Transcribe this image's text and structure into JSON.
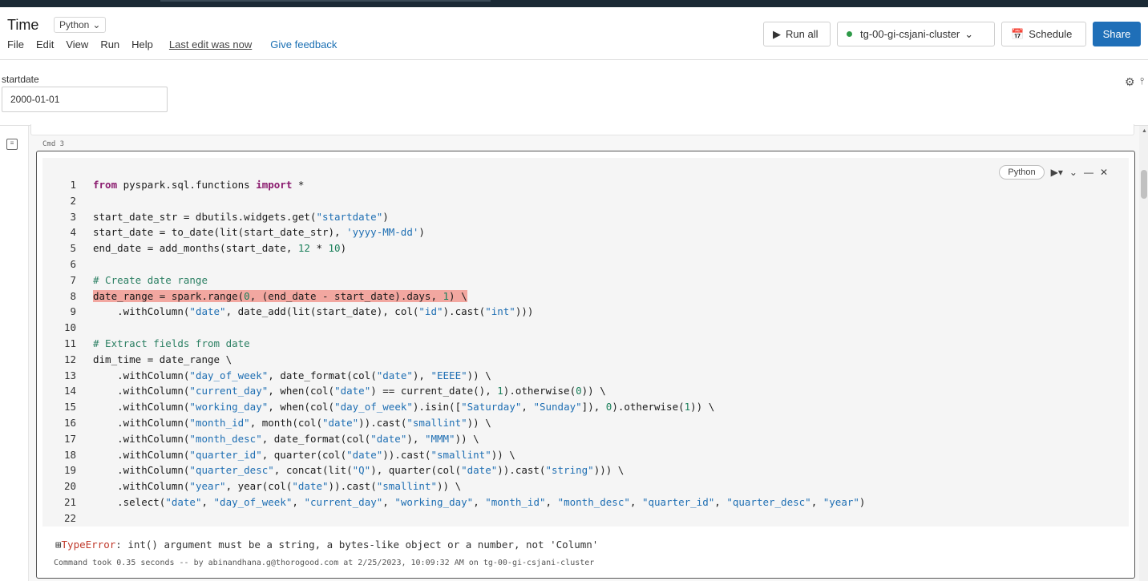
{
  "header": {
    "title": "Time",
    "language": "Python",
    "menu": [
      "File",
      "Edit",
      "View",
      "Run",
      "Help"
    ],
    "last_edit": "Last edit was now",
    "feedback": "Give feedback",
    "run_all": "Run all",
    "cluster": "tg-00-gi-csjani-cluster",
    "schedule": "Schedule",
    "share": "Share"
  },
  "widget": {
    "label": "startdate",
    "value": "2000-01-01"
  },
  "cell": {
    "cmd_label": "Cmd 3",
    "language_pill": "Python",
    "error_prefix": "⊞",
    "error_type": "TypeError",
    "error_message": ": int() argument must be a string, a bytes-like object or a number, not 'Column'",
    "command_info": "Command took 0.35 seconds -- by abinandhana.g@thorogood.com at 2/25/2023, 10:09:32 AM on tg-00-gi-csjani-cluster"
  },
  "code_lines": [
    {
      "n": "1",
      "text": "from pyspark.sql.functions import *"
    },
    {
      "n": "2",
      "text": ""
    },
    {
      "n": "3",
      "text": "start_date_str = dbutils.widgets.get(\"startdate\")"
    },
    {
      "n": "4",
      "text": "start_date = to_date(lit(start_date_str), 'yyyy-MM-dd')"
    },
    {
      "n": "5",
      "text": "end_date = add_months(start_date, 12 * 10)"
    },
    {
      "n": "6",
      "text": ""
    },
    {
      "n": "7",
      "text": "# Create date range"
    },
    {
      "n": "8",
      "text": "date_range = spark.range(0, (end_date - start_date).days, 1) \\"
    },
    {
      "n": "9",
      "text": "    .withColumn(\"date\", date_add(lit(start_date), col(\"id\").cast(\"int\")))"
    },
    {
      "n": "10",
      "text": ""
    },
    {
      "n": "11",
      "text": "# Extract fields from date"
    },
    {
      "n": "12",
      "text": "dim_time = date_range \\"
    },
    {
      "n": "13",
      "text": "    .withColumn(\"day_of_week\", date_format(col(\"date\"), \"EEEE\")) \\"
    },
    {
      "n": "14",
      "text": "    .withColumn(\"current_day\", when(col(\"date\") == current_date(), 1).otherwise(0)) \\"
    },
    {
      "n": "15",
      "text": "    .withColumn(\"working_day\", when(col(\"day_of_week\").isin([\"Saturday\", \"Sunday\"]), 0).otherwise(1)) \\"
    },
    {
      "n": "16",
      "text": "    .withColumn(\"month_id\", month(col(\"date\")).cast(\"smallint\")) \\"
    },
    {
      "n": "17",
      "text": "    .withColumn(\"month_desc\", date_format(col(\"date\"), \"MMM\")) \\"
    },
    {
      "n": "18",
      "text": "    .withColumn(\"quarter_id\", quarter(col(\"date\")).cast(\"smallint\")) \\"
    },
    {
      "n": "19",
      "text": "    .withColumn(\"quarter_desc\", concat(lit(\"Q\"), quarter(col(\"date\")).cast(\"string\"))) \\"
    },
    {
      "n": "20",
      "text": "    .withColumn(\"year\", year(col(\"date\")).cast(\"smallint\")) \\"
    },
    {
      "n": "21",
      "text": "    .select(\"date\", \"day_of_week\", \"current_day\", \"working_day\", \"month_id\", \"month_desc\", \"quarter_id\", \"quarter_desc\", \"year\")"
    },
    {
      "n": "22",
      "text": ""
    }
  ],
  "highlighted_line": "8",
  "colors": {
    "share": "#1f6fb8",
    "error": "#c0392b",
    "highlight": "#f2a7a0",
    "string": "#1f6fb3",
    "keyword": "#8a1a6e",
    "comment": "#2a7f62"
  }
}
